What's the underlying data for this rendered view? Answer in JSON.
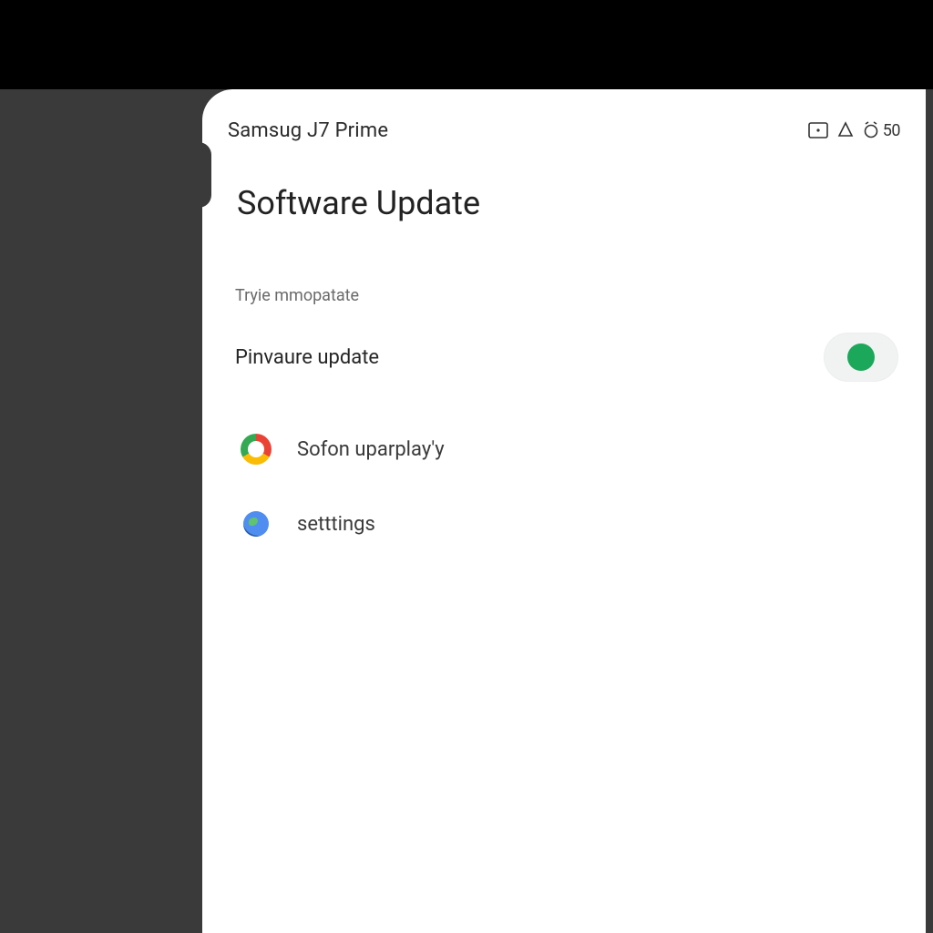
{
  "status": {
    "device_name": "Samsug J7 Prime",
    "battery_text": "50"
  },
  "page": {
    "title": "Software Update",
    "section_label": "Tryie mmopatate"
  },
  "rows": {
    "firmware_update": {
      "label": "Pinvaure update",
      "toggle_on": true
    }
  },
  "list": {
    "item_chrome": {
      "label": "Sofon uparplay'y"
    },
    "item_settings": {
      "label": "setttings"
    }
  }
}
